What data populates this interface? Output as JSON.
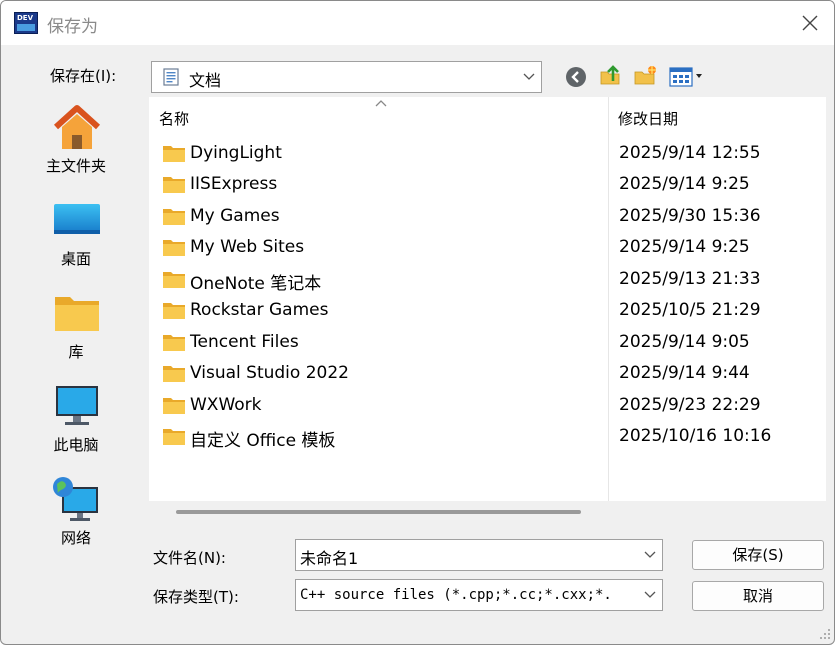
{
  "window": {
    "title": "保存为",
    "icon_text": "DEV"
  },
  "location": {
    "label": "保存在(I):",
    "value": "文档"
  },
  "toolbar": [
    {
      "name": "back-icon"
    },
    {
      "name": "up-folder-icon"
    },
    {
      "name": "new-folder-icon"
    },
    {
      "name": "view-menu-icon"
    }
  ],
  "places": [
    {
      "label": "主文件夹",
      "icon": "home-icon"
    },
    {
      "label": "桌面",
      "icon": "desktop-icon"
    },
    {
      "label": "库",
      "icon": "library-folder-icon"
    },
    {
      "label": "此电脑",
      "icon": "computer-icon"
    },
    {
      "label": "网络",
      "icon": "network-icon"
    }
  ],
  "file_list": {
    "columns": [
      "名称",
      "修改日期"
    ],
    "rows": [
      {
        "name": "DyingLight",
        "date": "2025/9/14 12:55"
      },
      {
        "name": "IISExpress",
        "date": "2025/9/14 9:25"
      },
      {
        "name": "My Games",
        "date": "2025/9/30 15:36"
      },
      {
        "name": "My Web Sites",
        "date": "2025/9/14 9:25"
      },
      {
        "name": "OneNote 笔记本",
        "date": "2025/9/13 21:33"
      },
      {
        "name": "Rockstar Games",
        "date": "2025/10/5 21:29"
      },
      {
        "name": "Tencent Files",
        "date": "2025/9/14 9:05"
      },
      {
        "name": "Visual Studio 2022",
        "date": "2025/9/14 9:44"
      },
      {
        "name": "WXWork",
        "date": "2025/9/23 22:29"
      },
      {
        "name": "自定义 Office 模板",
        "date": "2025/10/16 10:16"
      }
    ]
  },
  "filename": {
    "label": "文件名(N):",
    "value": "未命名1"
  },
  "filetype": {
    "label": "保存类型(T):",
    "value": "C++ source files (*.cpp;*.cc;*.cxx;*."
  },
  "buttons": {
    "save": "保存(S)",
    "cancel": "取消"
  },
  "colors": {
    "folder": "#f8c54a",
    "accent": "#1f7fd6"
  }
}
